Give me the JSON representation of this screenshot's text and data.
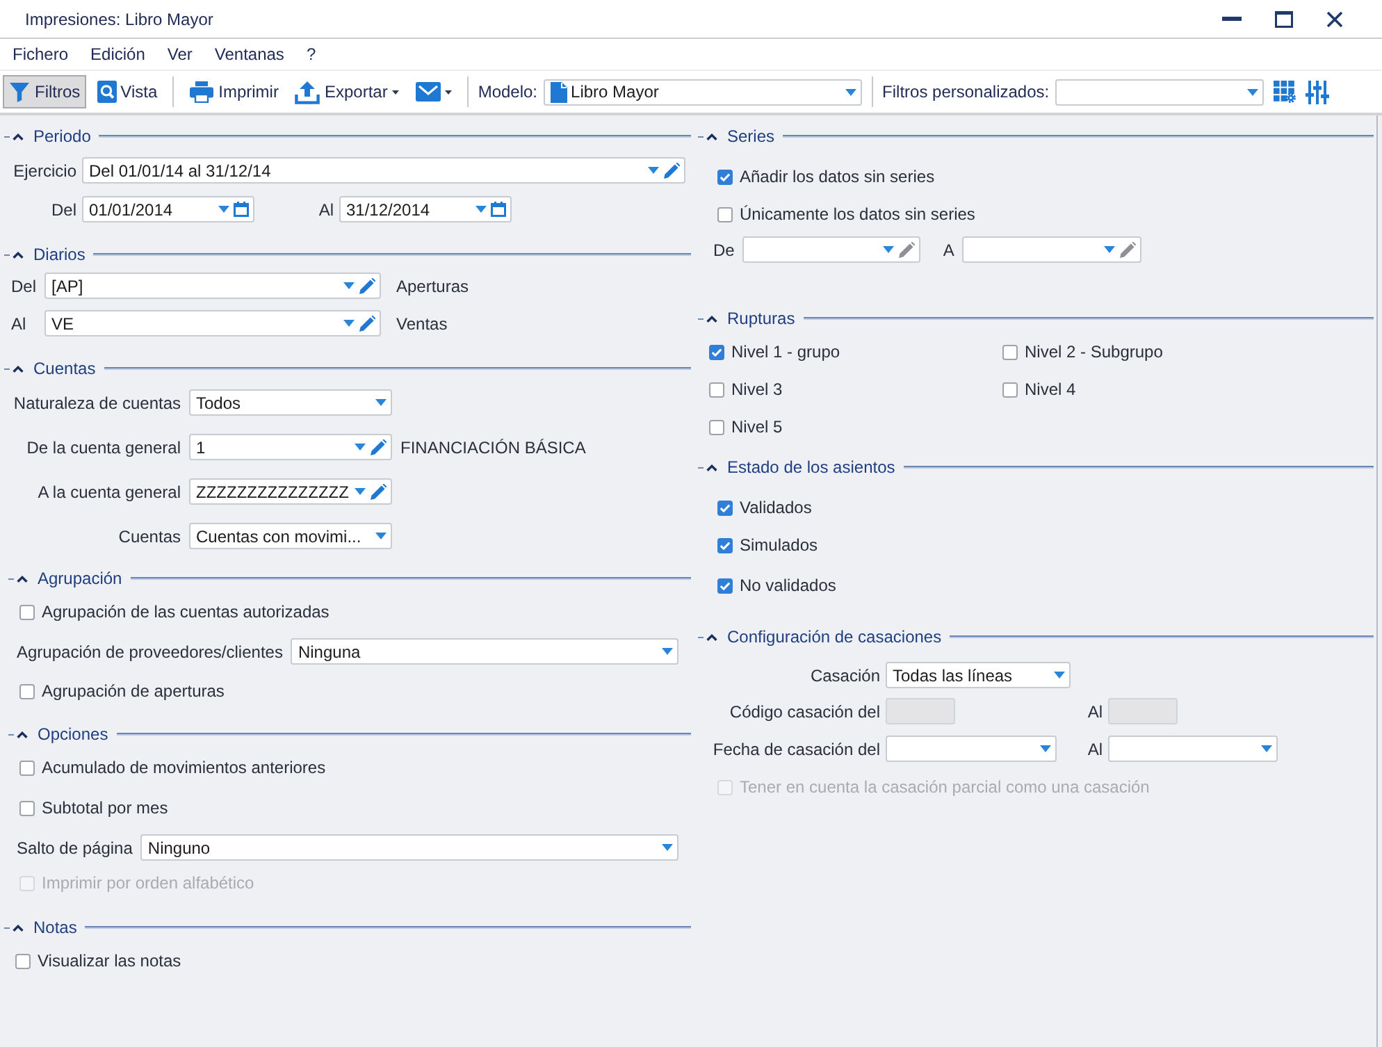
{
  "window": {
    "title": "Impresiones: Libro Mayor"
  },
  "menu": [
    "Fichero",
    "Edición",
    "Ver",
    "Ventanas",
    "?"
  ],
  "toolbar": {
    "groups": [
      [
        {
          "label": "Filtros",
          "selected": true,
          "dropdown": false
        },
        {
          "label": "Vista",
          "selected": false,
          "dropdown": false
        }
      ],
      [
        {
          "label": "Imprimir",
          "selected": false,
          "dropdown": false
        },
        {
          "label": "Exportar",
          "selected": false,
          "dropdown": true
        },
        {
          "selected": false,
          "dropdown": true
        }
      ]
    ],
    "model": {
      "label": "Modelo:",
      "value": "Libro Mayor"
    },
    "custom_filters": {
      "label": "Filtros personalizados:"
    }
  },
  "left_panel": {
    "period": {
      "title": "Periodo",
      "expanded": true,
      "fiscal_year": {
        "label": "Ejercicio",
        "value": "Del 01/01/14 al 31/12/14"
      },
      "from": {
        "label": "Del",
        "value": "01/01/2014"
      },
      "to": {
        "label": "Al",
        "value": "31/12/2014"
      }
    },
    "journals": {
      "title": "Diarios",
      "expanded": true,
      "from": {
        "label": "Del",
        "value": "[AP]",
        "description": "Aperturas"
      },
      "to": {
        "label": "Al",
        "value": "VE",
        "description": "Ventas"
      }
    },
    "accounts": {
      "title": "Cuentas",
      "expanded": true,
      "nature": {
        "label": "Naturaleza de cuentas",
        "value": "Todos"
      },
      "from_account": {
        "label": "De la cuenta general",
        "value": "1",
        "description": "FINANCIACIÓN BÁSICA"
      },
      "to_account": {
        "label": "A la cuenta general",
        "value": "ZZZZZZZZZZZZZZZ"
      },
      "scope": {
        "label": "Cuentas",
        "value": "Cuentas con movimi..."
      }
    },
    "grouping": {
      "title": "Agrupación",
      "expanded": true,
      "authorized_accounts": {
        "label": "Agrupación de las cuentas autorizadas",
        "checked": false,
        "disabled": false
      },
      "suppliers_customers": {
        "label": "Agrupación de proveedores/clientes",
        "value": "Ninguna"
      },
      "openings": {
        "label": "Agrupación de aperturas",
        "checked": false,
        "disabled": false
      }
    },
    "options": {
      "title": "Opciones",
      "expanded": true,
      "accumulated": {
        "label": "Acumulado de movimientos anteriores",
        "checked": false,
        "disabled": false
      },
      "monthly_subtotal": {
        "label": "Subtotal por mes",
        "checked": false,
        "disabled": false
      },
      "page_break": {
        "label": "Salto de página",
        "value": "Ninguno"
      },
      "alphabetical": {
        "label": "Imprimir por orden alfabético",
        "checked": false,
        "disabled": true
      }
    },
    "notes": {
      "title": "Notas",
      "expanded": true,
      "show_notes": {
        "label": "Visualizar las notas",
        "checked": false,
        "disabled": false
      }
    }
  },
  "right_panel": {
    "series": {
      "title": "Series",
      "expanded": true,
      "options": [
        {
          "label": "Añadir los datos sin series",
          "checked": true,
          "disabled": false
        },
        {
          "label": "Únicamente los datos sin series",
          "checked": false,
          "disabled": false
        }
      ],
      "from": {
        "label": "De"
      },
      "to": {
        "label": "A"
      }
    },
    "breaks": {
      "title": "Rupturas",
      "expanded": true,
      "levels": [
        {
          "label": "Nivel 1 - grupo",
          "checked": true,
          "disabled": false
        },
        {
          "label": "Nivel 2 - Subgrupo",
          "checked": false,
          "disabled": false
        },
        {
          "label": "Nivel 3",
          "checked": false,
          "disabled": false
        },
        {
          "label": "Nivel 4",
          "checked": false,
          "disabled": false
        },
        {
          "label": "Nivel 5",
          "checked": false,
          "disabled": false
        }
      ]
    },
    "entry_status": {
      "title": "Estado de los asientos",
      "expanded": true,
      "states": [
        {
          "label": "Validados",
          "checked": true,
          "disabled": false
        },
        {
          "label": "Simulados",
          "checked": true,
          "disabled": false
        },
        {
          "label": "No validados",
          "checked": true,
          "disabled": false
        }
      ]
    },
    "matching": {
      "title": "Configuración de casaciones",
      "expanded": true,
      "type": {
        "label": "Casación",
        "value": "Todas las líneas"
      },
      "code_from": {
        "label": "Código casación del",
        "disabled": true
      },
      "code_to": {
        "label": "Al",
        "disabled": true
      },
      "date_from": {
        "label": "Fecha de casación del"
      },
      "date_to": {
        "label": "Al"
      },
      "partial": {
        "label": "Tener en cuenta la casación parcial como una casación",
        "checked": false,
        "disabled": true
      }
    }
  }
}
